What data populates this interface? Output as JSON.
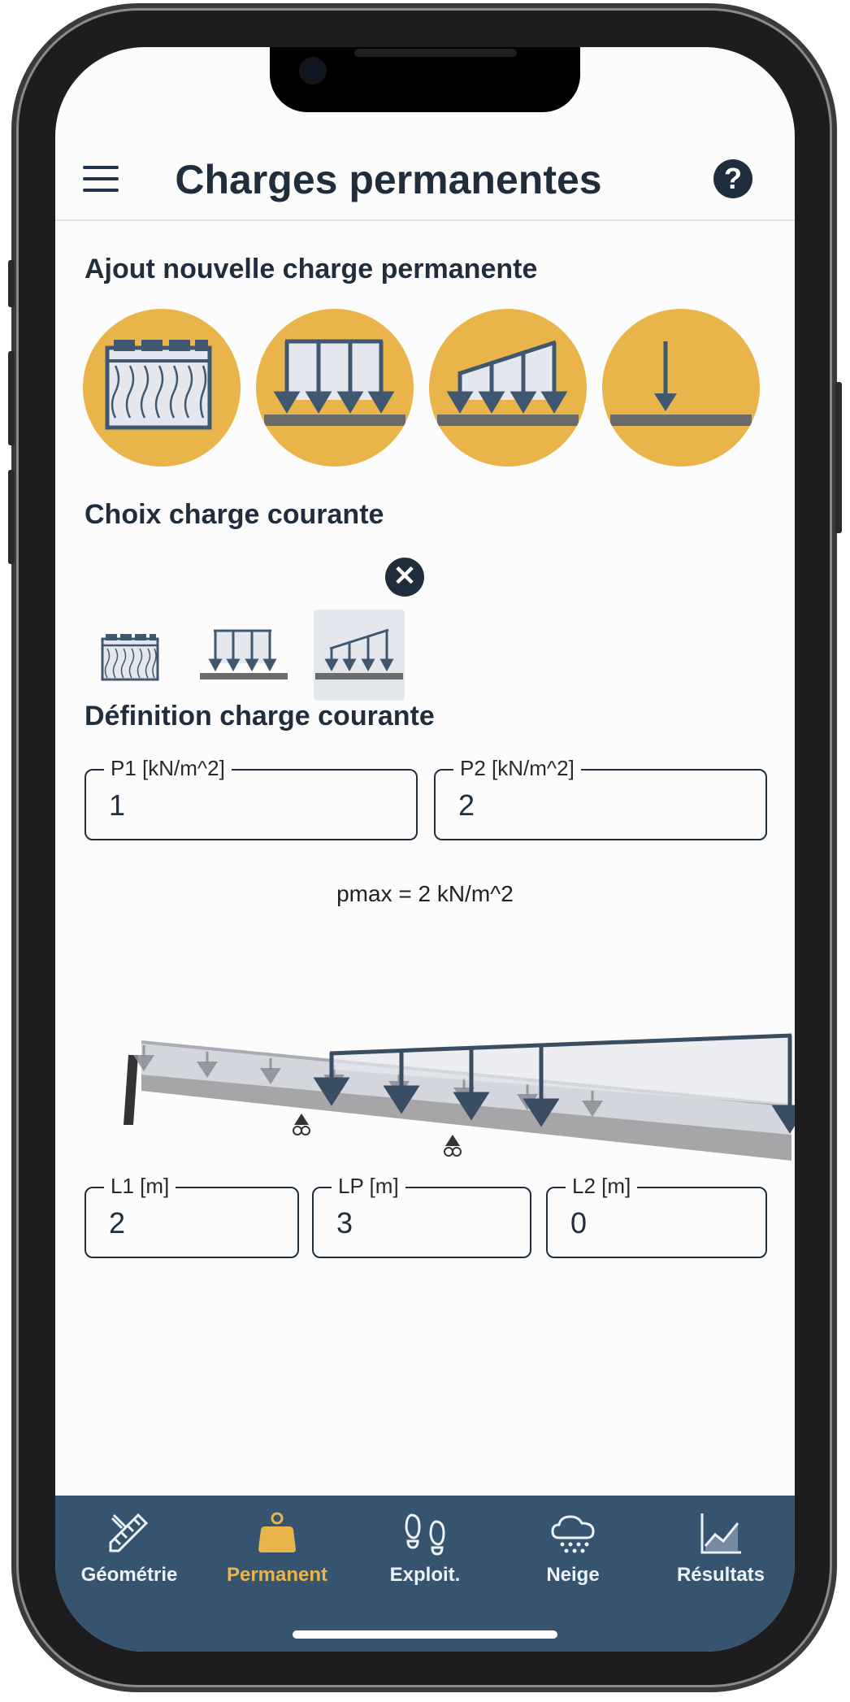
{
  "header": {
    "title": "Charges permanentes"
  },
  "sections": {
    "add_new": "Ajout nouvelle charge permanente",
    "choice": "Choix charge courante",
    "definition": "Définition charge courante"
  },
  "add_options": [
    {
      "icon": "insulation-wall-icon"
    },
    {
      "icon": "uniform-load-icon"
    },
    {
      "icon": "trapezoidal-load-icon"
    },
    {
      "icon": "point-load-icon"
    }
  ],
  "current_charges": [
    {
      "icon": "insulation-wall-icon",
      "selected": false
    },
    {
      "icon": "uniform-load-icon",
      "selected": false
    },
    {
      "icon": "trapezoidal-load-icon",
      "selected": true
    }
  ],
  "fields": {
    "p1": {
      "label": "P1 [kN/m^2]",
      "value": "1"
    },
    "p2": {
      "label": "P2 [kN/m^2]",
      "value": "2"
    },
    "l1": {
      "label": "L1 [m]",
      "value": "2"
    },
    "lp": {
      "label": "LP [m]",
      "value": "3"
    },
    "l2": {
      "label": "L2 [m]",
      "value": "0"
    }
  },
  "pmax_text": "pmax = 2 kN/m^2",
  "tabs": [
    {
      "label": "Géométrie",
      "icon": "geometry-icon",
      "active": false
    },
    {
      "label": "Permanent",
      "icon": "weight-icon",
      "active": true
    },
    {
      "label": "Exploit.",
      "icon": "footprints-icon",
      "active": false
    },
    {
      "label": "Neige",
      "icon": "snow-cloud-icon",
      "active": false
    },
    {
      "label": "Résultats",
      "icon": "chart-icon",
      "active": false
    }
  ],
  "colors": {
    "accent": "#e9b54b",
    "navy": "#1f2d3d",
    "tabbar": "#365470"
  }
}
